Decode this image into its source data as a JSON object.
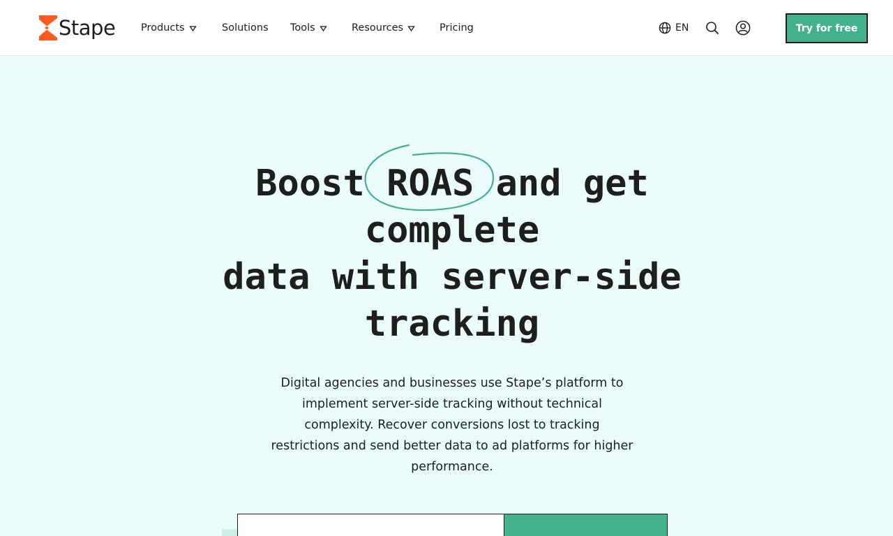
{
  "brand": {
    "name": "Stape",
    "accent_color": "#43b18a",
    "logo_color": "#ff5a1f"
  },
  "nav": {
    "items": [
      {
        "label": "Products",
        "has_dropdown": true
      },
      {
        "label": "Solutions",
        "has_dropdown": false
      },
      {
        "label": "Tools",
        "has_dropdown": true
      },
      {
        "label": "Resources",
        "has_dropdown": true
      },
      {
        "label": "Pricing",
        "has_dropdown": false
      }
    ],
    "language": "EN",
    "icons": [
      "globe-icon",
      "search-icon",
      "user-icon"
    ],
    "cta_label": "Try for free"
  },
  "hero": {
    "title_part1": "Boost",
    "title_highlight": "ROAS",
    "title_part2": "and get complete",
    "title_part3": "data with server-side tracking",
    "description": "Digital agencies and businesses use Stape’s platform to implement server-side tracking without technical complexity. Recover conversions lost to tracking restrictions and send better data to ad platforms for higher performance."
  },
  "signup_form": {
    "email_value": "",
    "email_placeholder": "",
    "submit_label": ""
  }
}
